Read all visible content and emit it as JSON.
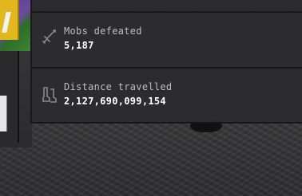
{
  "stats": [
    {
      "label": "Mobs defeated",
      "value": "5,187",
      "icon": "sword-icon"
    },
    {
      "label": "Distance travelled",
      "value": "2,127,690,099,154",
      "icon": "boots-icon"
    }
  ],
  "colors": {
    "panel": "#2c2c2e",
    "label_text": "#bdbdbd",
    "value_text": "#ffffff",
    "icon": "#8a8a8a"
  }
}
